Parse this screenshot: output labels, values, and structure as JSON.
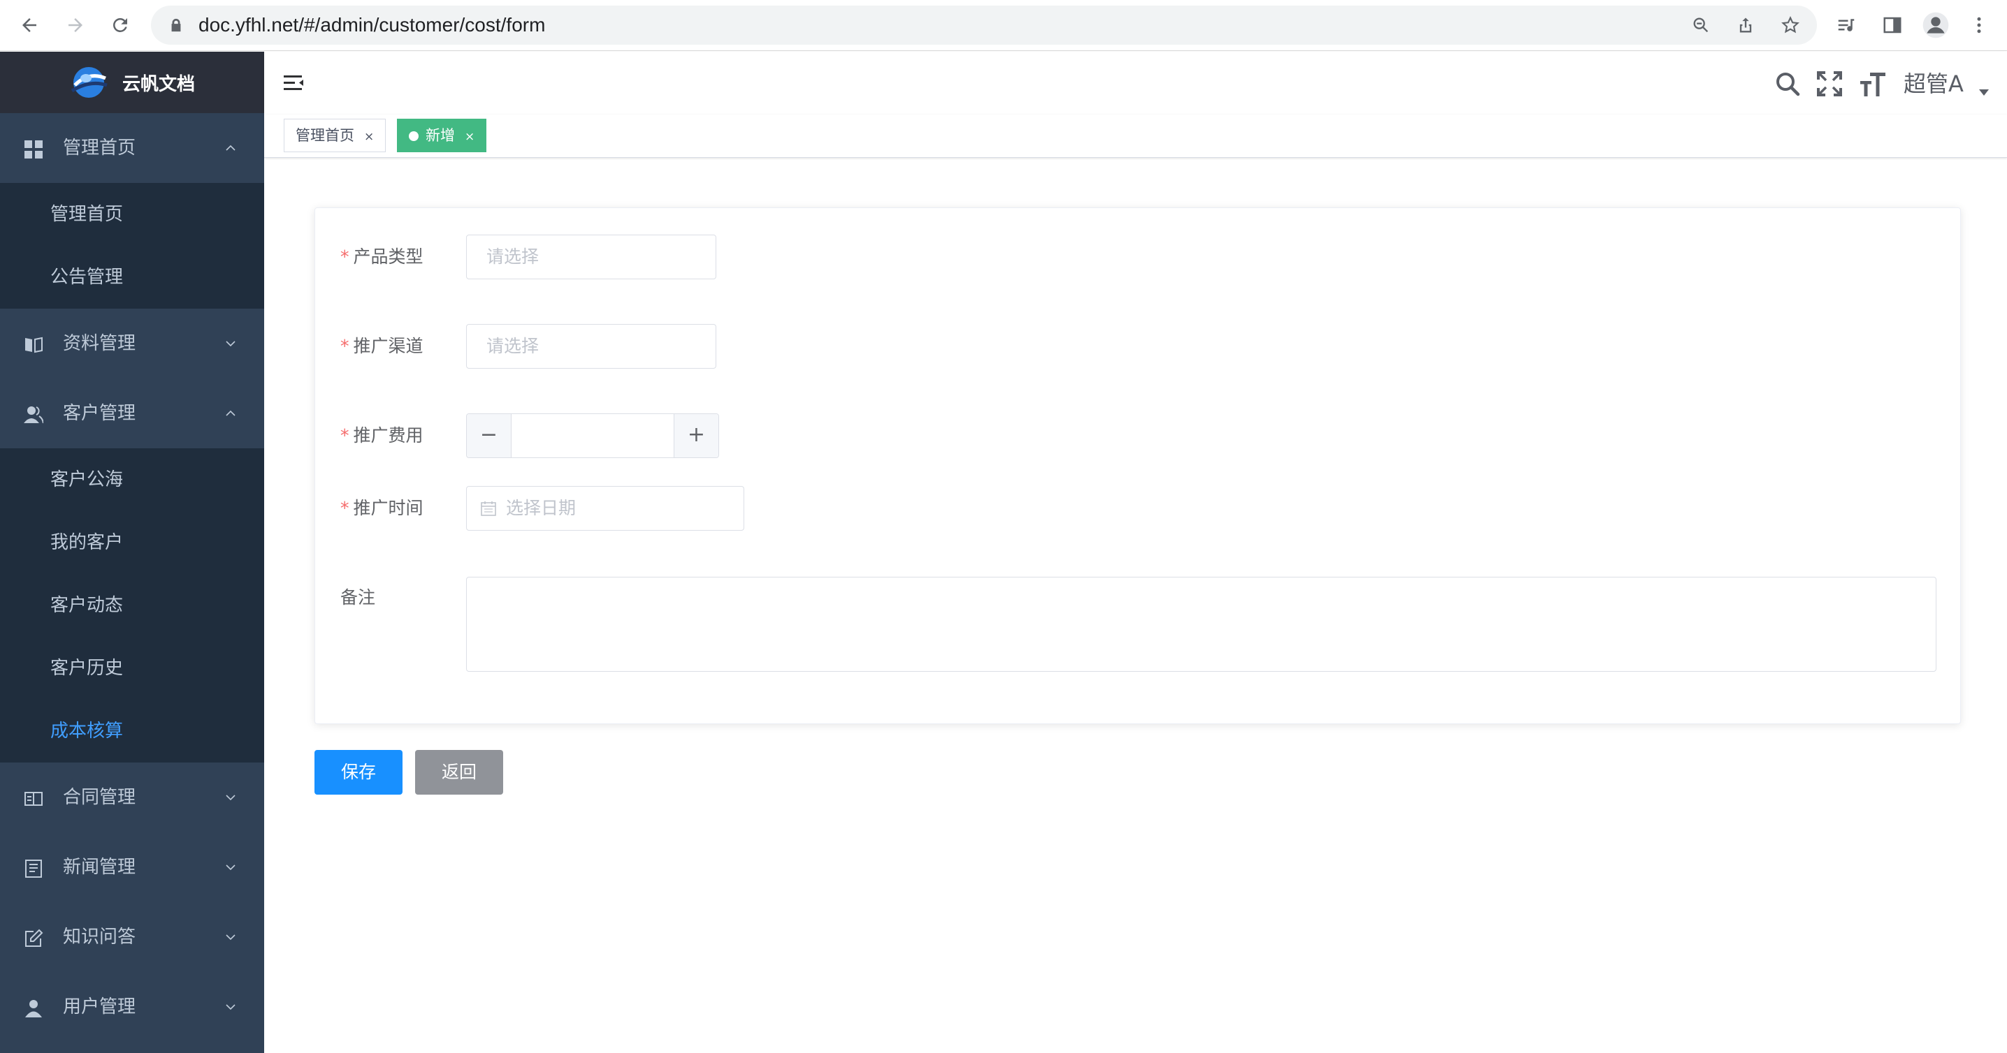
{
  "browser": {
    "url": "doc.yfhl.net/#/admin/customer/cost/form"
  },
  "sidebar": {
    "logo_text": "云帆文档",
    "groups": [
      {
        "label": "管理首页",
        "icon": "dashboard-icon",
        "expanded": true,
        "items": [
          {
            "label": "管理首页"
          },
          {
            "label": "公告管理"
          }
        ]
      },
      {
        "label": "资料管理",
        "icon": "book-icon",
        "expanded": false
      },
      {
        "label": "客户管理",
        "icon": "users-icon",
        "expanded": true,
        "items": [
          {
            "label": "客户公海"
          },
          {
            "label": "我的客户"
          },
          {
            "label": "客户动态"
          },
          {
            "label": "客户历史"
          },
          {
            "label": "成本核算",
            "active": true
          }
        ]
      },
      {
        "label": "合同管理",
        "icon": "contract-icon",
        "expanded": false
      },
      {
        "label": "新闻管理",
        "icon": "news-icon",
        "expanded": false
      },
      {
        "label": "知识问答",
        "icon": "edit-icon",
        "expanded": false
      },
      {
        "label": "用户管理",
        "icon": "user-icon",
        "expanded": false
      }
    ]
  },
  "navbar": {
    "user_name": "超管A"
  },
  "tags": [
    {
      "label": "管理首页",
      "close": "×",
      "active": false
    },
    {
      "label": "新增",
      "close": "×",
      "active": true
    }
  ],
  "form": {
    "product_type": {
      "label": "产品类型",
      "required": "*",
      "placeholder": "请选择"
    },
    "channel": {
      "label": "推广渠道",
      "required": "*",
      "placeholder": "请选择"
    },
    "cost": {
      "label": "推广费用",
      "required": "*",
      "value": "",
      "minus": "−",
      "plus": "+"
    },
    "date": {
      "label": "推广时间",
      "required": "*",
      "placeholder": "选择日期"
    },
    "remark": {
      "label": "备注",
      "value": ""
    }
  },
  "actions": {
    "save_label": "保存",
    "back_label": "返回"
  },
  "colors": {
    "sidebar_bg": "#304156",
    "submenu_bg": "#1f2d3d",
    "active_menu": "#409eff",
    "active_tag": "#42b983",
    "primary": "#1890ff",
    "required": "#f56c6c"
  }
}
